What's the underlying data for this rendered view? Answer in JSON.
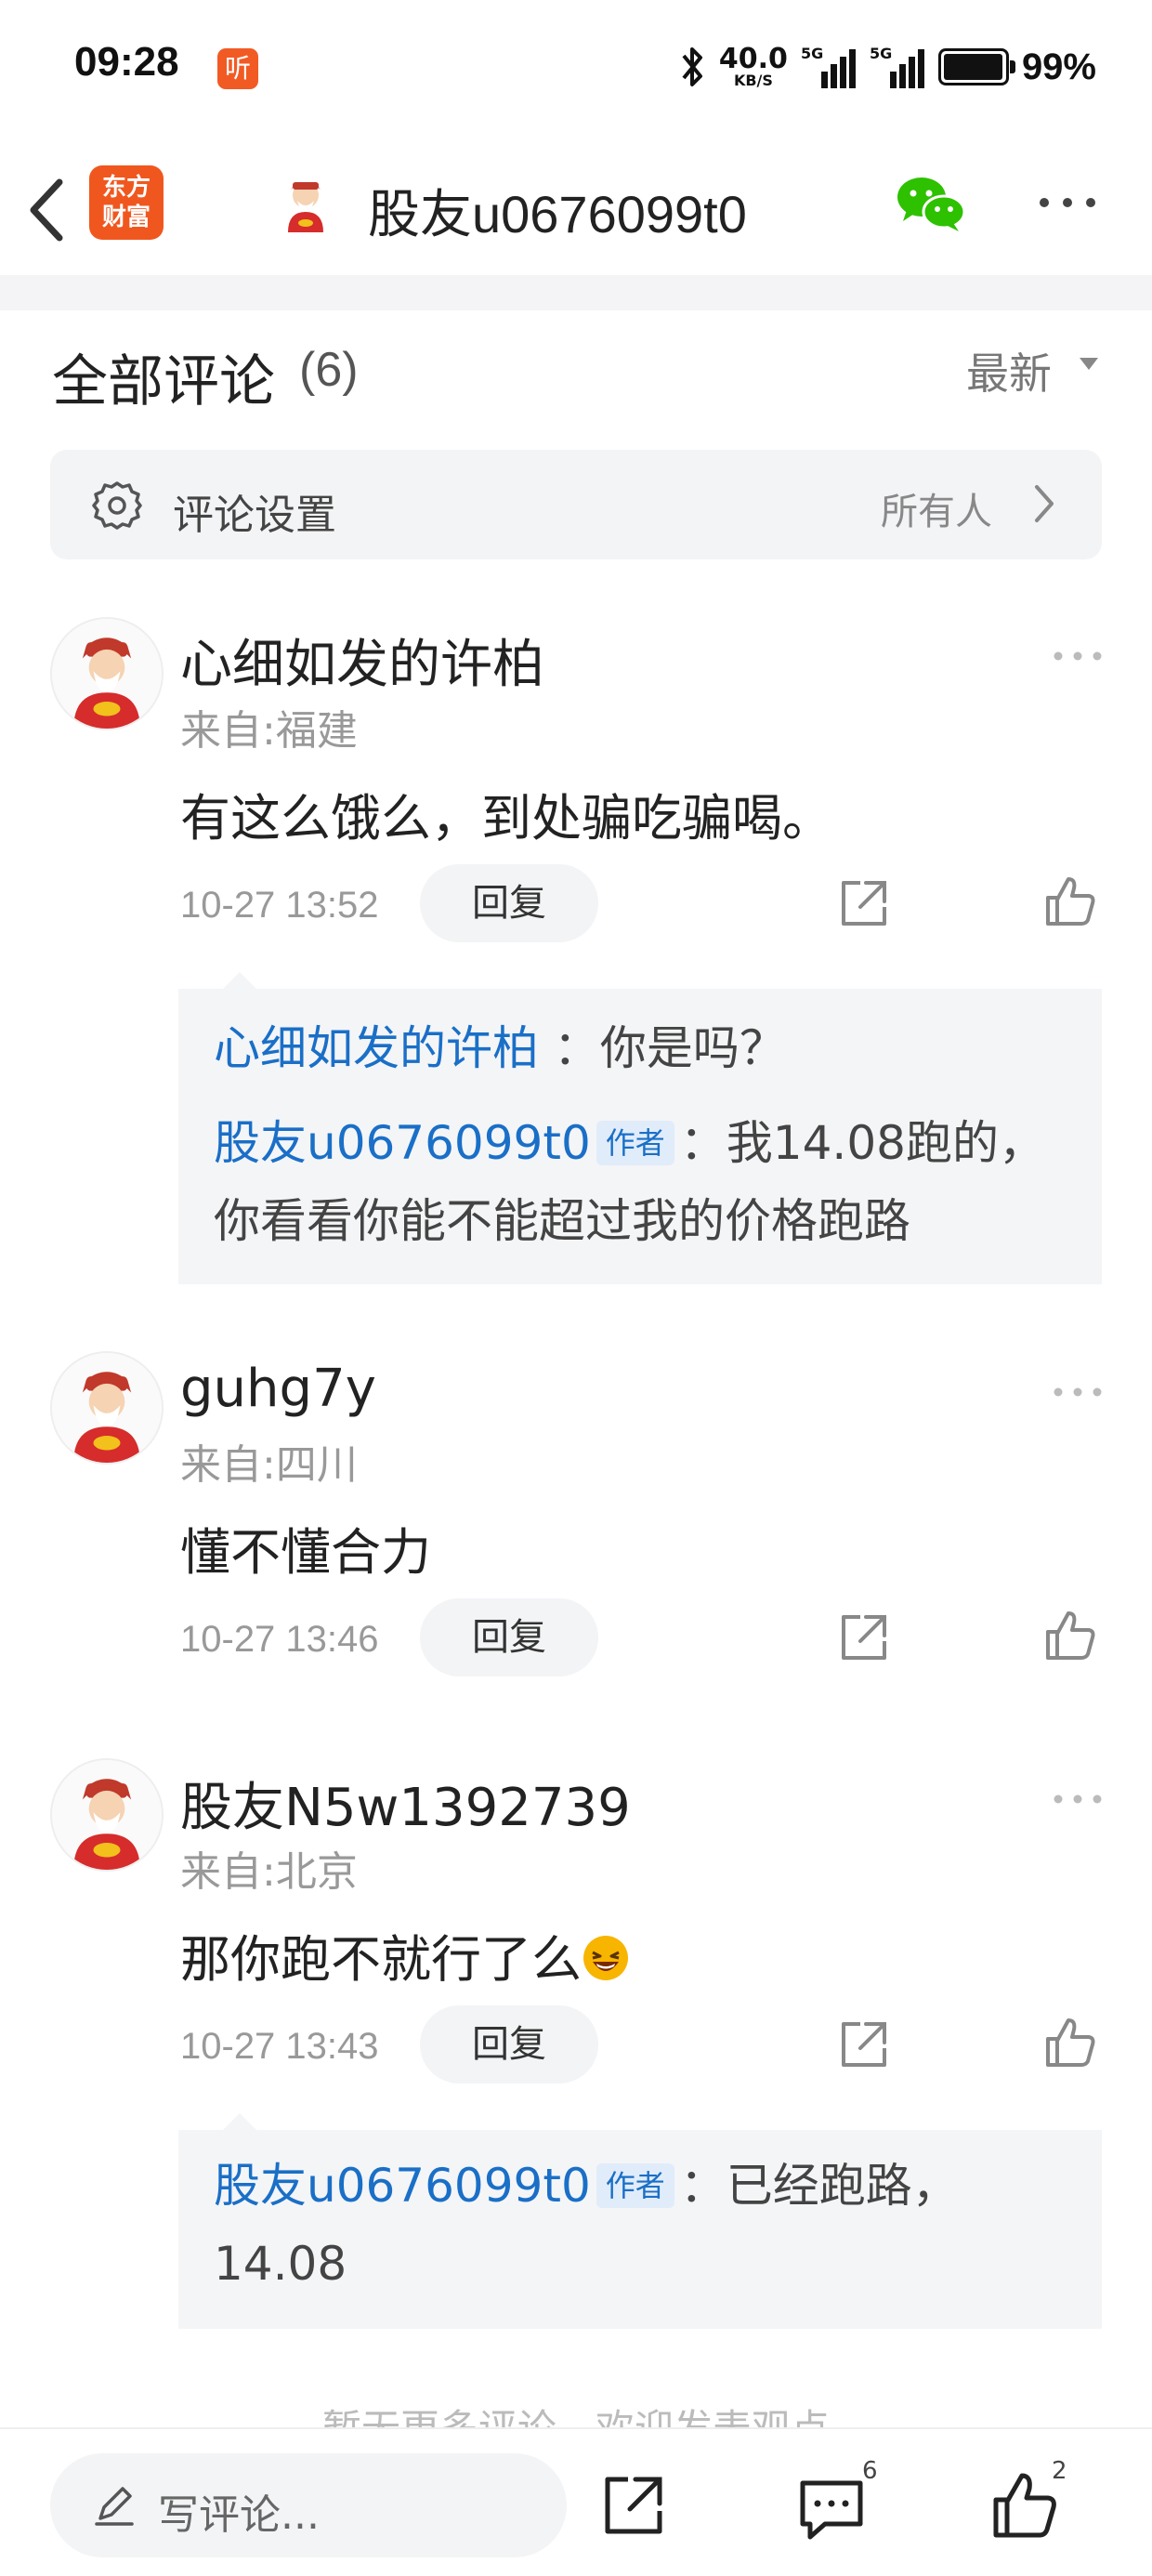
{
  "status_bar": {
    "time": "09:28",
    "listen_badge": "听",
    "net_speed_value": "40.0",
    "net_speed_unit": "KB/S",
    "battery_percent": "99%",
    "battery_level": 0.99
  },
  "header": {
    "app_logo_line1": "东方",
    "app_logo_line2": "财富",
    "title": "股友u0676099t0",
    "icons": [
      "back-icon",
      "app-logo",
      "avatar",
      "wechat-icon",
      "more-icon"
    ]
  },
  "comments_section": {
    "title": "全部评论",
    "count": "(6)",
    "sort_label": "最新",
    "settings_label": "评论设置",
    "settings_value": "所有人"
  },
  "comments": [
    {
      "author": "心细如发的许柏",
      "location": "来自:福建",
      "text": "有这么饿么，到处骗吃骗喝。",
      "time": "10-27 13:52",
      "reply_label": "回复",
      "replies": [
        {
          "author": "心细如发的许柏",
          "is_author": false,
          "text": "：你是吗？"
        },
        {
          "author": "股友u0676099t0",
          "is_author": true,
          "tag": "作者",
          "text": "：我14.08跑的，你看看你能不能超过我的价格跑路"
        }
      ]
    },
    {
      "author": "guhg7y",
      "location": "来自:四川",
      "text": "懂不懂合力",
      "time": "10-27 13:46",
      "reply_label": "回复",
      "replies": []
    },
    {
      "author": "股友N5w1392739",
      "location": "来自:北京",
      "text": "那你跑不就行了么",
      "emoji": "laughing-emoji",
      "time": "10-27 13:43",
      "reply_label": "回复",
      "replies": [
        {
          "author": "股友u0676099t0",
          "is_author": true,
          "tag": "作者",
          "text": "：已经跑路，14.08"
        }
      ]
    }
  ],
  "end_note": "暂无更多评论，欢迎发表观点",
  "bottom_bar": {
    "compose_placeholder": "写评论...",
    "comment_count": "6",
    "like_count": "2"
  },
  "colors": {
    "brand_orange": "#f0571f",
    "link_blue": "#1a6fc7",
    "wechat_green": "#2dc100"
  }
}
